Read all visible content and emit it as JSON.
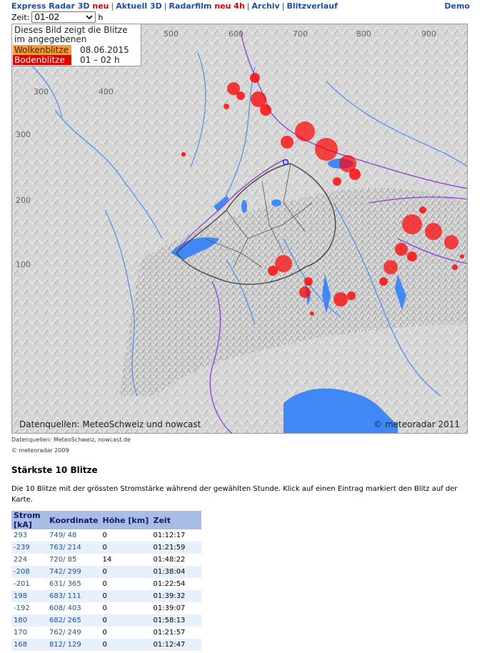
{
  "nav": {
    "items": [
      {
        "label": "Express Radar 3D",
        "badge": "neu"
      },
      {
        "label": "Aktuell 3D",
        "badge": ""
      },
      {
        "label": "Radarfilm",
        "badge": "neu 4h"
      },
      {
        "label": "Archiv",
        "badge": ""
      },
      {
        "label": "Blitzverlauf",
        "badge": ""
      }
    ],
    "demo": "Demo",
    "separator": "|"
  },
  "zeit": {
    "label": "Zeit:",
    "value": "01-02",
    "unit": "h"
  },
  "legend": {
    "line1": "Dieses Bild zeigt die Blitze",
    "line2": "im angegebenen Zeitintervall",
    "wolken_label": "Wolkenblitze",
    "wolken_value": "08.06.2015",
    "boden_label": "Bodenblitze",
    "boden_value": "01 – 02 h",
    "wolken_color": "#f59b39",
    "boden_color": "#e00000"
  },
  "map": {
    "source_text": "Datenquellen: MeteoSchweiz und nowcast",
    "copyright": "© meteoradar 2011",
    "x_ticks": [
      "500",
      "600",
      "700",
      "800",
      "900"
    ],
    "x_ticks_inner": [
      "300",
      "400"
    ],
    "y_ticks": [
      "300",
      "200",
      "100"
    ],
    "colors": {
      "water": "#4a8ff0",
      "lake": "#3f88f5",
      "border": "#8a3fd6",
      "strike": "#ff0000",
      "terrain": "#d2d2d2"
    }
  },
  "sources": "Datenquellen: MeteoSchweiz, nowcast.de",
  "copyright": "© meteoradar 2009",
  "section": {
    "title": "Stärkste 10 Blitze",
    "description": "Die 10 Blitze mit der grössten Stromstärke während der gewählten Stunde. Klick auf einen Eintrag markiert den Blitz auf der Karte."
  },
  "table": {
    "headers": [
      "Strom [kA]",
      "Koordinate",
      "Höhe [km]",
      "Zeit"
    ],
    "rows": [
      [
        "293",
        "749/ 48",
        "0",
        "01:12:17"
      ],
      [
        "-239",
        "763/ 214",
        "0",
        "01:21:59"
      ],
      [
        "224",
        "720/ 85",
        "14",
        "01:48:22"
      ],
      [
        "-208",
        "742/ 299",
        "0",
        "01:38:04"
      ],
      [
        "-201",
        "631/ 365",
        "0",
        "01:22:54"
      ],
      [
        "198",
        "683/ 111",
        "0",
        "01:39:32"
      ],
      [
        "-192",
        "608/ 403",
        "0",
        "01:39:07"
      ],
      [
        "180",
        "682/ 265",
        "0",
        "01:58:13"
      ],
      [
        "170",
        "762/ 249",
        "0",
        "01:21:57"
      ],
      [
        "168",
        "812/ 129",
        "0",
        "01:12:47"
      ]
    ]
  }
}
